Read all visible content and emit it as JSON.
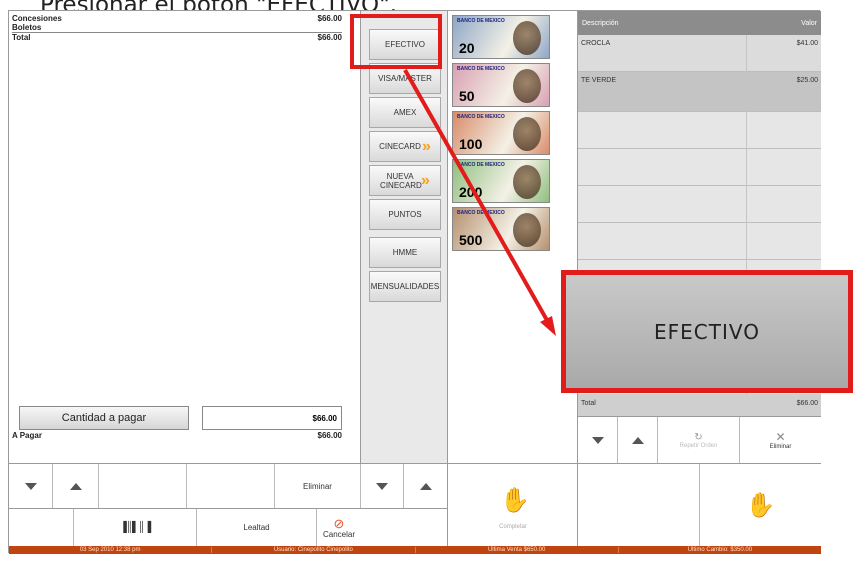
{
  "caption": "Presionar el botón \"EFECTIVO\".",
  "receipt": {
    "lines": [
      {
        "label": "Concesiones",
        "value": "$66.00"
      },
      {
        "label": "Boletos",
        "value": ""
      },
      {
        "label": "Total",
        "value": "$66.00"
      }
    ],
    "cantidad_label": "Cantidad a pagar",
    "cantidad_value": "$66.00",
    "a_pagar_label": "A Pagar",
    "a_pagar_value": "$66.00"
  },
  "left_toolbar": {
    "eliminar_label": "Eliminar",
    "lealtad_label": "Lealtad",
    "cancelar_label": "Cancelar"
  },
  "payment_methods": [
    "EFECTIVO",
    "VISA/MASTER",
    "AMEX",
    "CINECARD",
    "NUEVA CINECARD",
    "PUNTOS",
    "HMME",
    "MENSUALIDADES"
  ],
  "bills": [
    {
      "label": "BANCO DE MEXICO",
      "value": "20",
      "color": "#8fa6c7"
    },
    {
      "label": "BANCO DE MEXICO",
      "value": "50",
      "color": "#d8a0b2"
    },
    {
      "label": "BANCO DE MEXICO",
      "value": "100",
      "color": "#d88c6a"
    },
    {
      "label": "BANCO DE MEXICO",
      "value": "200",
      "color": "#8fbf7f"
    },
    {
      "label": "BANCO DE MEXICO",
      "value": "500",
      "color": "#b58f6e"
    }
  ],
  "completar_label": "Completar",
  "order": {
    "col_desc": "Descripción",
    "col_valor": "Valor",
    "rows": [
      {
        "desc": "CROCLA",
        "valor": "$41.00"
      },
      {
        "desc": "TE VERDE",
        "valor": "$25.00"
      }
    ],
    "total_label": "Total",
    "total_value": "$66.00",
    "repetir_label": "Repetir Orden",
    "eliminar_label": "Eliminar"
  },
  "status_bar": [
    "03 Sep 2010 12:38 pm",
    "Usuario:  Cinepolito  Cinepolito",
    "Última Venta  $650.00",
    "Último Cambio:  $350.00"
  ],
  "zoom_label": "EFECTIVO",
  "colors": {
    "highlight": "#e21b1b",
    "status": "#c0440f"
  }
}
